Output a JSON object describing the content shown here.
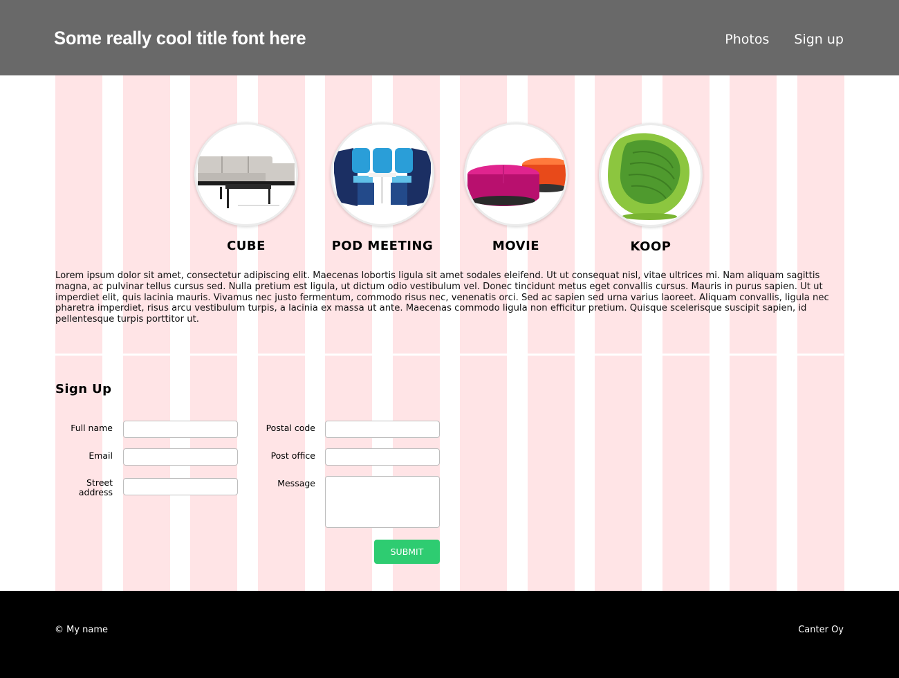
{
  "header": {
    "title": "Some really cool title font here",
    "nav": [
      "Photos",
      "Sign up"
    ]
  },
  "products": [
    {
      "name": "CUBE",
      "icon": "sofa-icon"
    },
    {
      "name": "POD MEETING",
      "icon": "meeting-pod-icon"
    },
    {
      "name": "MOVIE",
      "icon": "ottoman-icon"
    },
    {
      "name": "KOOP",
      "icon": "lounge-chair-icon"
    }
  ],
  "intro": "Lorem ipsum dolor sit amet, consectetur adipiscing elit. Maecenas lobortis ligula sit amet sodales eleifend. Ut ut consequat nisl, vitae ultrices mi. Nam aliquam sagittis magna, ac pulvinar tellus cursus sed. Nulla pretium est ligula, ut dictum odio vestibulum vel. Donec tincidunt metus eget convallis cursus. Mauris in purus sapien. Ut ut imperdiet elit, quis lacinia mauris. Vivamus nec justo fermentum, commodo risus nec, venenatis orci. Sed ac sapien sed urna varius laoreet. Aliquam convallis, ligula nec pharetra imperdiet, risus arcu vestibulum turpis, a lacinia ex massa ut ante. Maecenas commodo ligula non efficitur pretium. Quisque scelerisque suscipit sapien, id pellentesque turpis porttitor ut.",
  "signup": {
    "heading": "Sign Up",
    "full_name_label": "Full name",
    "email_label": "Email",
    "street_label_line1": "Street",
    "street_label_line2": "address",
    "postal_label": "Postal code",
    "post_office_label": "Post office",
    "message_label": "Message",
    "submit_label": "SUBMIT"
  },
  "footer": {
    "left": "© My name",
    "right": "Canter Oy"
  },
  "colors": {
    "header_bg": "#696969",
    "grid_overlay": "#ffe4e6",
    "submit_bg": "#2ecc71",
    "footer_bg": "#000000"
  }
}
